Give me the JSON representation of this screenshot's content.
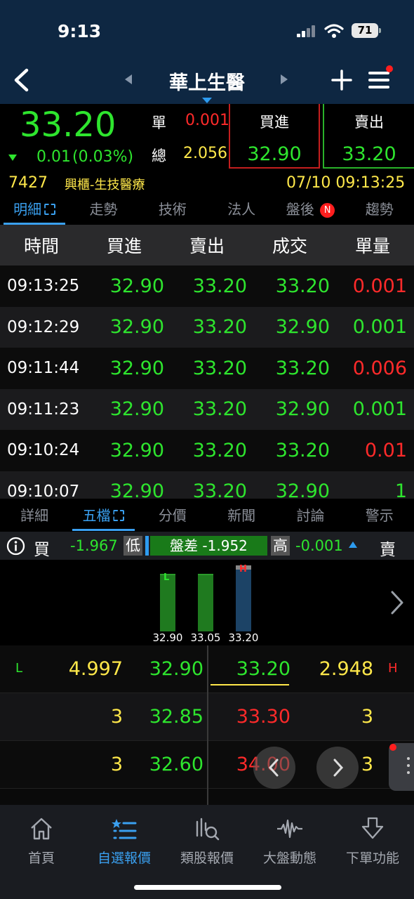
{
  "status_bar": {
    "time": "9:13",
    "battery": "71"
  },
  "nav": {
    "title": "華上生醫"
  },
  "quote": {
    "price": "33.20",
    "change": "0.01",
    "change_pct": "(0.03%)",
    "unit_label": "單",
    "unit_value": "0.001",
    "total_label": "總",
    "total_value": "2.056",
    "bid_label": "買進",
    "bid_value": "32.90",
    "ask_label": "賣出",
    "ask_value": "33.20",
    "code": "7427",
    "market": "興櫃-生技醫療",
    "datetime": "07/10 09:13:25"
  },
  "top_tabs": [
    "明細",
    "走勢",
    "技術",
    "法人",
    "盤後",
    "趨勢"
  ],
  "top_tab_badge": "N",
  "ticks": {
    "headers": [
      "時間",
      "買進",
      "賣出",
      "成交",
      "單量"
    ],
    "rows": [
      {
        "time": "09:13:25",
        "bid": "32.90",
        "ask": "33.20",
        "deal": "33.20",
        "vol": "0.001",
        "vol_color": "red"
      },
      {
        "time": "09:12:29",
        "bid": "32.90",
        "ask": "33.20",
        "deal": "32.90",
        "vol": "0.001",
        "vol_color": "green"
      },
      {
        "time": "09:11:44",
        "bid": "32.90",
        "ask": "33.20",
        "deal": "33.20",
        "vol": "0.006",
        "vol_color": "red"
      },
      {
        "time": "09:11:23",
        "bid": "32.90",
        "ask": "33.20",
        "deal": "32.90",
        "vol": "0.001",
        "vol_color": "green"
      },
      {
        "time": "09:10:24",
        "bid": "32.90",
        "ask": "33.20",
        "deal": "33.20",
        "vol": "0.01",
        "vol_color": "red"
      },
      {
        "time": "09:10:07",
        "bid": "32.90",
        "ask": "33.20",
        "deal": "32.90",
        "vol": "1",
        "vol_color": "green"
      }
    ]
  },
  "mid_tabs": [
    "詳細",
    "五檔",
    "分價",
    "新聞",
    "討論",
    "警示"
  ],
  "ratio": {
    "buy_label": "買",
    "buy_value": "-1.967",
    "low_label": "低",
    "diff_label": "盤差 -1.952",
    "high_label": "高",
    "sell_value": "-0.001",
    "sell_label": "賣"
  },
  "price_chart": {
    "bars": [
      {
        "price": "32.90",
        "level": 0.82,
        "marker": "L",
        "color": "#1f7a1f"
      },
      {
        "price": "33.05",
        "level": 0.82,
        "marker": "",
        "color": "#1f7a1f"
      },
      {
        "price": "33.20",
        "level": 0.94,
        "marker": "H",
        "color": "#1c4366"
      }
    ]
  },
  "order_book": [
    {
      "left_marker": "L",
      "bid_vol": "4.997",
      "bid": "32.90",
      "ask": "33.20",
      "ask_vol": "2.948",
      "right_marker": "H"
    },
    {
      "left_marker": "",
      "bid_vol": "3",
      "bid": "32.85",
      "ask": "33.30",
      "ask_vol": "3",
      "right_marker": ""
    },
    {
      "left_marker": "",
      "bid_vol": "3",
      "bid": "32.60",
      "ask": "34.00",
      "ask_vol": "3",
      "right_marker": ""
    }
  ],
  "bottom_nav": [
    "首頁",
    "自選報價",
    "類股報價",
    "大盤動態",
    "下單功能"
  ],
  "colors": {
    "accent": "#3aa0f0",
    "up": "#ff2a2a",
    "down": "#2ee52e",
    "nav_bg": "#0e2742"
  }
}
